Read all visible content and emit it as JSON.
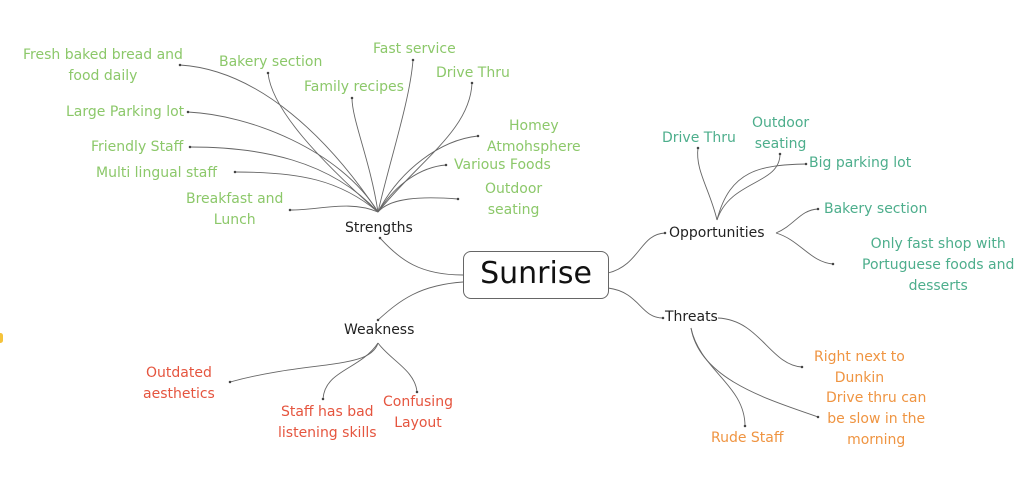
{
  "root": {
    "label": "Sunrise"
  },
  "colors": {
    "strengths": "#8cc86a",
    "opportunities": "#4dae8c",
    "weakness": "#e5553f",
    "threats": "#ef9441"
  },
  "strengths": {
    "label": "Strengths",
    "items": [
      "Fresh baked bread and\nfood daily",
      "Bakery section",
      "Fast service",
      "Family recipes",
      "Drive Thru",
      "Large Parking lot",
      "Homey\nAtmohsphere",
      "Friendly Staff",
      "Various Foods",
      "Multi lingual staff",
      "Outdoor\nseating",
      "Breakfast and\nLunch"
    ]
  },
  "opportunities": {
    "label": "Opportunities",
    "items": [
      "Drive Thru",
      "Outdoor\nseating",
      "Big parking lot",
      "Bakery section",
      "Only fast shop with\nPortuguese foods and\ndesserts"
    ]
  },
  "weakness": {
    "label": "Weakness",
    "items": [
      "Outdated\naesthetics",
      "Staff has bad\nlistening skills",
      "Confusing\nLayout"
    ]
  },
  "threats": {
    "label": "Threats",
    "items": [
      "Right next to\nDunkin",
      "Drive thru can\nbe slow in the\nmorning",
      "Rude Staff"
    ]
  }
}
